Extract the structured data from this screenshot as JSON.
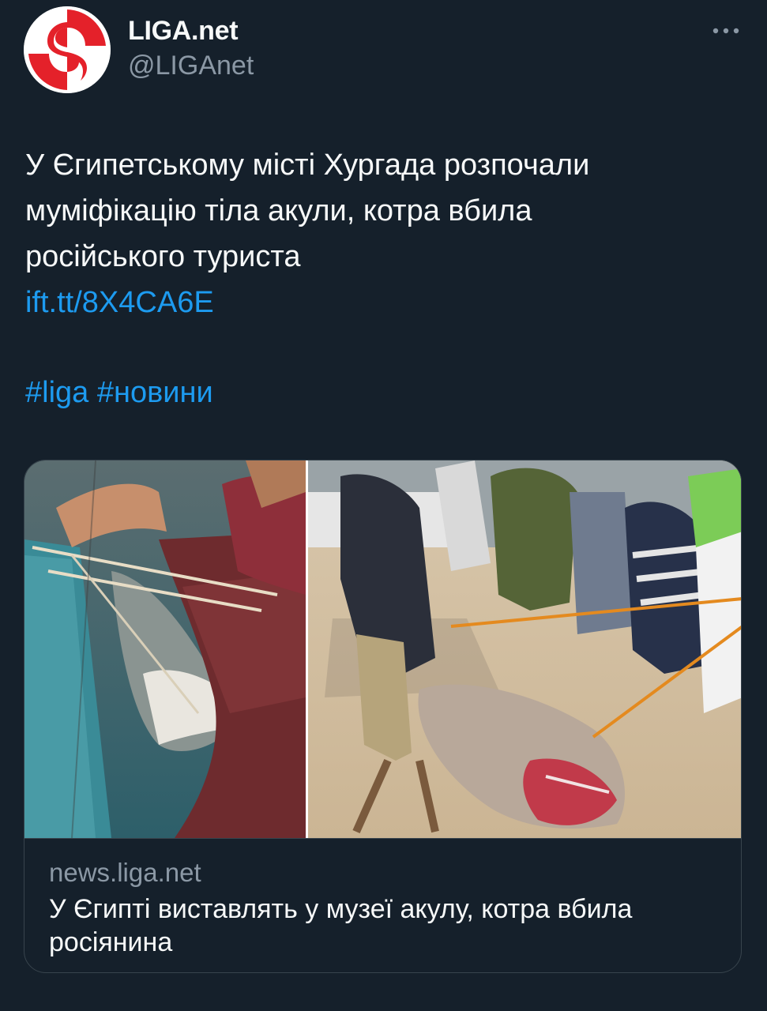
{
  "author": {
    "display_name": "LIGA.net",
    "handle": "@LIGAnet",
    "avatar_icon": "liga-logo-icon",
    "brand_color": "#e4212a"
  },
  "more_icon": "more-horizontal-icon",
  "tweet": {
    "text_lines": [
      "У Єгипетському місті Хургада розпочали",
      "муміфікацію тіла акули, котра вбила",
      "російського туриста"
    ],
    "link": "ift.tt/8X4CA6E",
    "hashtags": [
      "#liga",
      "#новини"
    ]
  },
  "card": {
    "domain": "news.liga.net",
    "title_lines": [
      "У Єгипті виставлять у музеї акулу, котра вбила",
      "росіянина"
    ]
  },
  "colors": {
    "background": "#15202b",
    "text": "#f7f9f9",
    "muted": "#8b98a5",
    "link": "#1d9bf0",
    "border": "#38444d"
  }
}
